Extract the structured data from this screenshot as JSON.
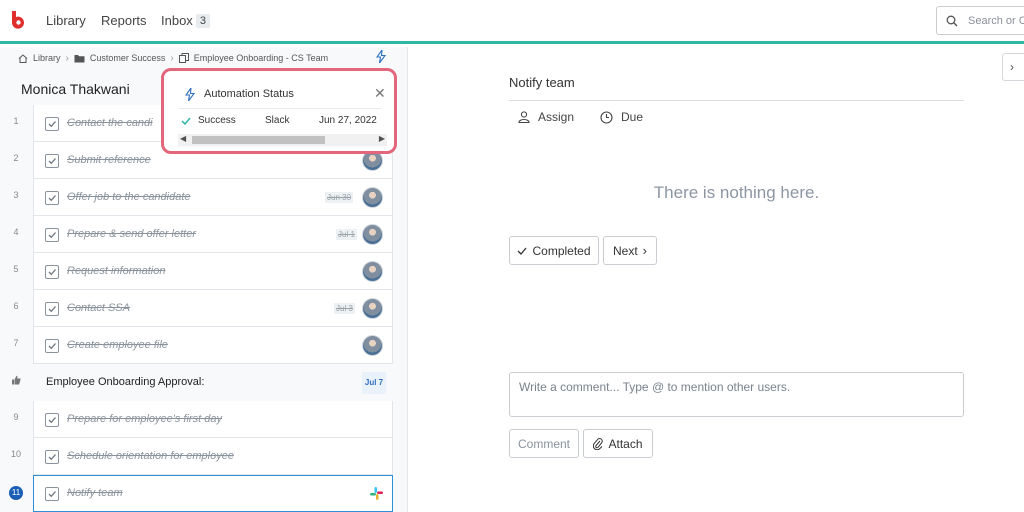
{
  "nav": {
    "items": [
      {
        "label": "Library"
      },
      {
        "label": "Reports"
      },
      {
        "label": "Inbox",
        "count": "3"
      }
    ],
    "search_placeholder": "Search or C",
    "accent_color": "#2fb7a6",
    "logo_color": "#e0302e"
  },
  "breadcrumbs": [
    {
      "label": "Library",
      "icon": "home-icon"
    },
    {
      "label": "Customer Success",
      "icon": "folder-icon"
    },
    {
      "label": "Employee Onboarding - CS Team",
      "icon": "copy-icon"
    }
  ],
  "assignee_name": "Monica Thakwani",
  "tasks": [
    {
      "num": "1",
      "title": "Contact the candi",
      "due": ""
    },
    {
      "num": "2",
      "title": "Submit reference",
      "due": ""
    },
    {
      "num": "3",
      "title": "Offer job to the candidate",
      "due": "Jun 30"
    },
    {
      "num": "4",
      "title": "Prepare & send offer letter",
      "due": "Jul 1"
    },
    {
      "num": "5",
      "title": "Request information",
      "due": ""
    },
    {
      "num": "6",
      "title": "Contact SSA",
      "due": "Jul 3"
    },
    {
      "num": "7",
      "title": "Create employee file",
      "due": ""
    },
    {
      "num": "",
      "title": "Employee Onboarding Approval:",
      "due": "Jul 7",
      "type": "approval",
      "icon": "thumbs-up-icon"
    },
    {
      "num": "9",
      "title": "Prepare for employee's first day",
      "due": ""
    },
    {
      "num": "10",
      "title": "Schedule orientation for employee",
      "due": ""
    },
    {
      "num": "11",
      "title": "Notify team",
      "due": "",
      "active": true
    }
  ],
  "automation_popover": {
    "title": "Automation Status",
    "status": "Success",
    "app": "Slack",
    "date": "Jun 27, 2022",
    "border_color": "#e2667c"
  },
  "detail": {
    "title": "Notify team",
    "assign_label": "Assign",
    "due_label": "Due",
    "empty_text": "There is nothing here.",
    "completed_label": "Completed",
    "next_label": "Next",
    "comment_placeholder": "Write a comment... Type @ to mention other users.",
    "comment_button": "Comment",
    "attach_button": "Attach"
  }
}
